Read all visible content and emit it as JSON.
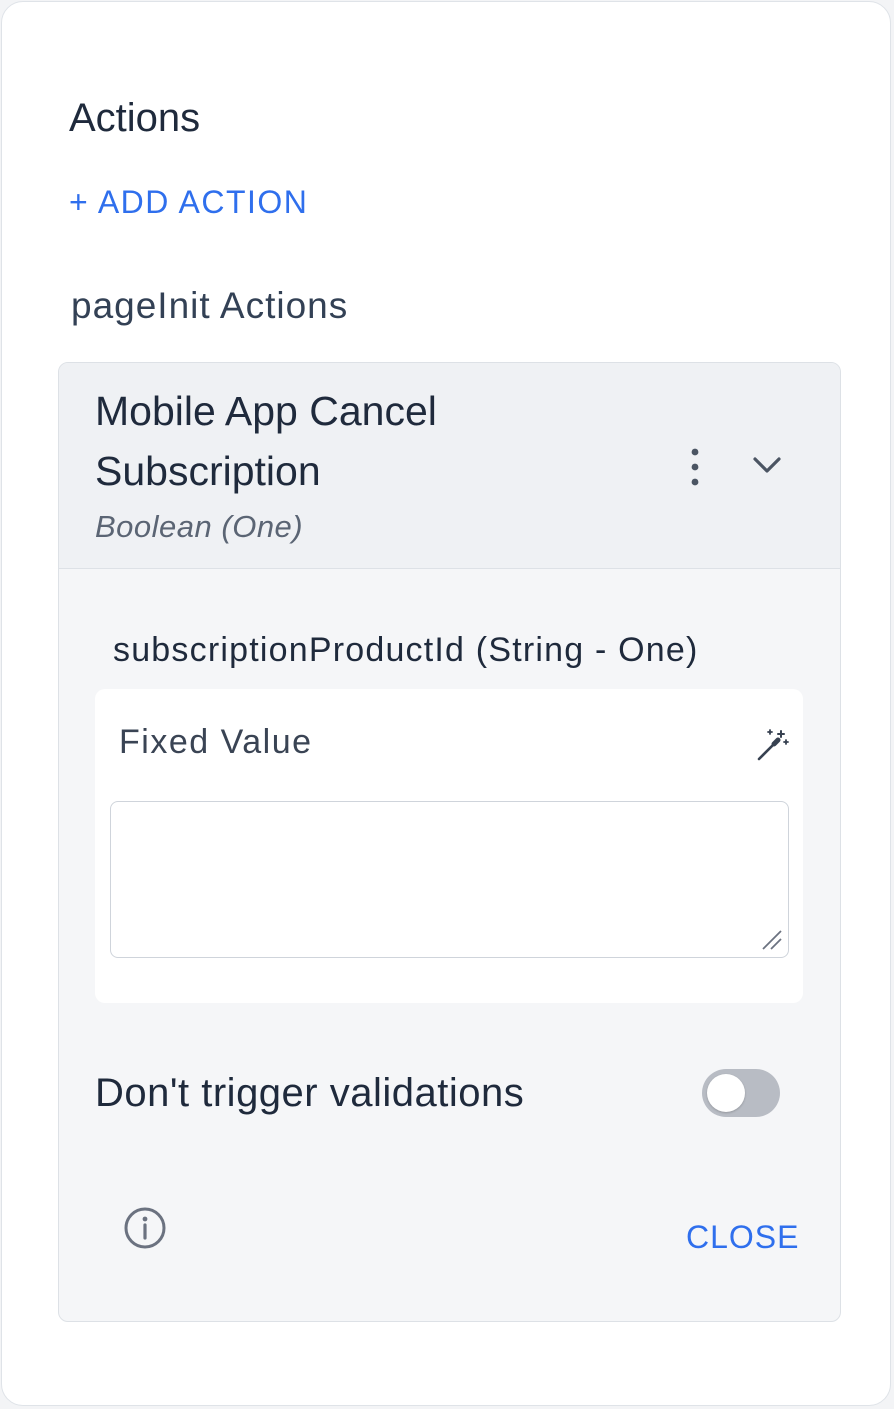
{
  "panel": {
    "title": "Actions",
    "add_action_label": "+ ADD ACTION",
    "section_title": "pageInit Actions"
  },
  "action_card": {
    "title": "Mobile App Cancel Subscription",
    "subtitle": "Boolean (One)",
    "menu_icon": "kebab-icon",
    "collapse_icon": "chevron-down-icon",
    "parameter": {
      "label": "subscriptionProductId (String - One)",
      "value_mode_label": "Fixed Value",
      "mode_icon": "magic-wand-icon",
      "value": "",
      "placeholder": ""
    },
    "toggle": {
      "label": "Don't trigger validations",
      "enabled": false
    },
    "info_icon": "info-icon",
    "close_label": "CLOSE"
  },
  "colors": {
    "accent": "#2f6fed",
    "text": "#1f2a3c",
    "card_bg": "#f5f6f8",
    "toggle_off": "#b8bcc4"
  }
}
